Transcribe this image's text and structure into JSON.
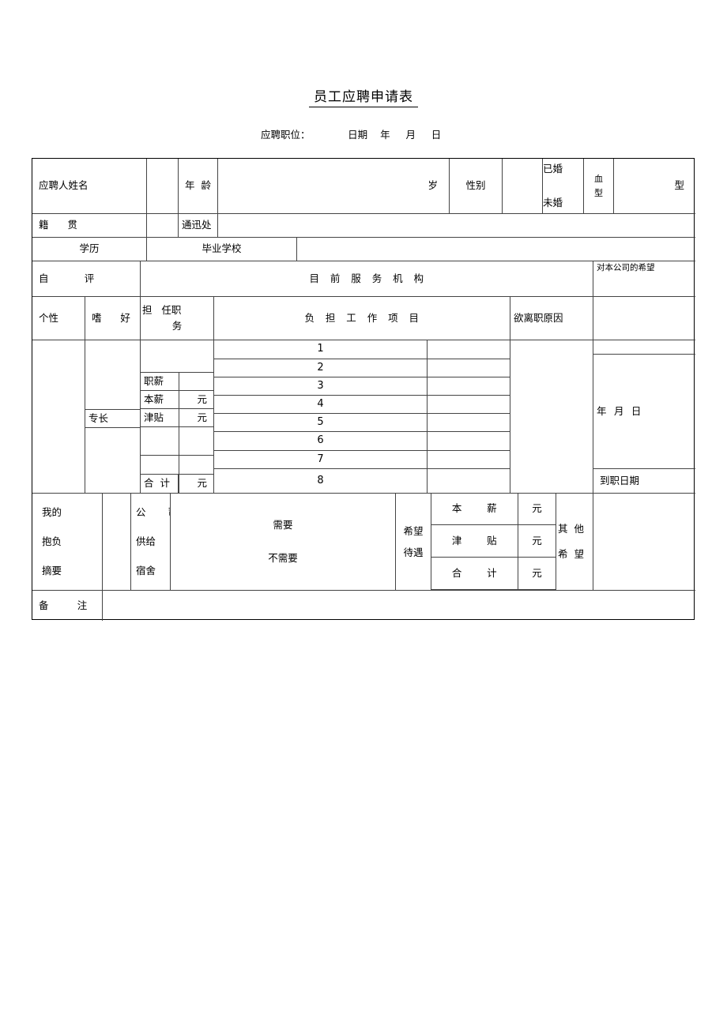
{
  "document": {
    "title": "员工应聘申请表",
    "subheader": "应聘职位：            日期    年     月     日"
  },
  "row_identity": {
    "name_label": "应聘人姓名",
    "name_value": "",
    "age_label": "年  龄",
    "age_value": "",
    "age_unit": "岁",
    "gender_label": "性别",
    "gender_value": "",
    "marital_married": "已婚",
    "marital_single": "未婚",
    "blood_label_1": "血",
    "blood_label_2": "型",
    "blood_value": "",
    "blood_unit": "型"
  },
  "row_origin": {
    "native_place_label": "籍      贯",
    "native_place_value": "",
    "address_label": "通迅处",
    "address_value": ""
  },
  "row_education": {
    "education_label": "学历",
    "school_label": "毕业学校",
    "school_value": ""
  },
  "row_section_headers": {
    "self_eval": "自          评",
    "current_employer": "目   前   服   务   机   构",
    "hope_for_company": "对本公司的希望"
  },
  "row_subheaders": {
    "personality": "个性",
    "hobby": "嗜      好",
    "position_held_1": "担   任职",
    "position_held_2": "务",
    "work_items": "负   担   工   作   项   目",
    "leave_reason": "欲离职原因"
  },
  "work_rows": [
    "1",
    "2",
    "3",
    "4",
    "5",
    "6",
    "7",
    "8"
  ],
  "salary_block": {
    "specialty_label": "专长",
    "rows": [
      {
        "label": "职薪",
        "unit": ""
      },
      {
        "label": "本薪",
        "unit": "元"
      },
      {
        "label": "津贴",
        "unit": "元"
      },
      {
        "label": "",
        "unit": ""
      },
      {
        "label": "",
        "unit": ""
      },
      {
        "label": "合  计",
        "unit": "元"
      }
    ]
  },
  "right_column": {
    "date_line": "年  月  日",
    "onboard_date_label": "到职日期",
    "onboard_date_value": ""
  },
  "bottom_section": {
    "ambition_1": "我的",
    "ambition_2": "抱负",
    "ambition_3": "摘要",
    "ambition_value": "",
    "company_provide_1": "公       司",
    "company_provide_2": "供给",
    "company_provide_3": "宿舍",
    "need_yes": "需要",
    "need_no": "不需要",
    "expected_1": "希望",
    "expected_2": "待遇",
    "pay_rows": [
      {
        "label": "本       薪",
        "unit": "元",
        "value": ""
      },
      {
        "label": "津       贴",
        "unit": "元",
        "value": ""
      },
      {
        "label": "合       计",
        "unit": "元",
        "value": ""
      }
    ],
    "other_wish_1": "其  他",
    "other_wish_2": "希  望",
    "other_wish_value": "",
    "remark_label": "备        注",
    "remark_value": ""
  }
}
